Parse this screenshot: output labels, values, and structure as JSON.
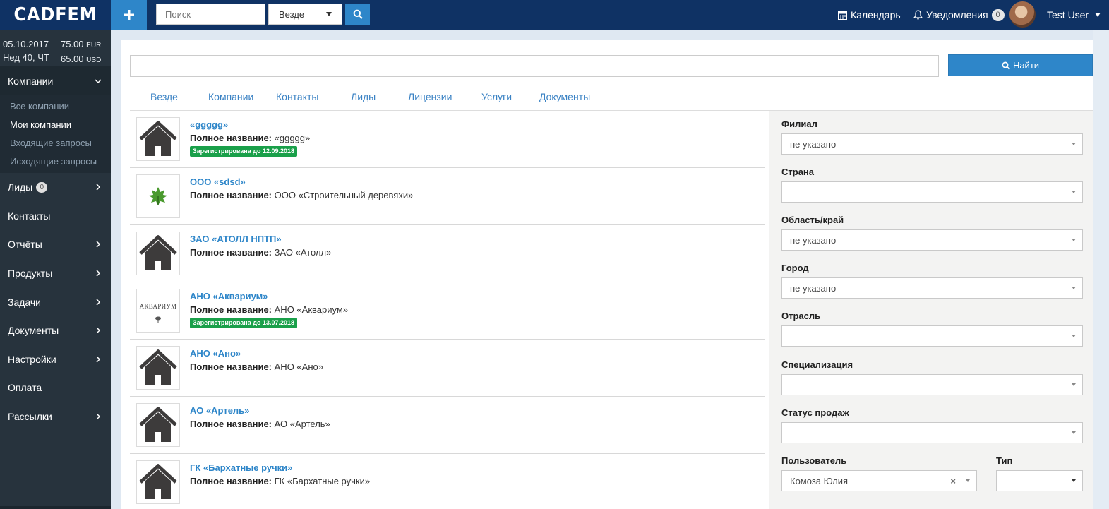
{
  "topbar": {
    "logo": "CADFEM",
    "search_placeholder": "Поиск",
    "scope_value": "Везде",
    "calendar_label": "Календарь",
    "notifications_label": "Уведомления",
    "notifications_count": "0",
    "user_name": "Test User"
  },
  "sidebar": {
    "date": "05.10.2017",
    "week": "Нед 40, ЧТ",
    "eur_rate": "75.00",
    "eur_code": "EUR",
    "usd_rate": "65.00",
    "usd_code": "USD",
    "active_section": "Компании",
    "sub_items": [
      "Все компании",
      "Мои компании",
      "Входящие запросы",
      "Исходящие запросы"
    ],
    "items": [
      "Лиды",
      "Контакты",
      "Отчёты",
      "Продукты",
      "Задачи",
      "Документы",
      "Настройки",
      "Оплата",
      "Рассылки"
    ],
    "leads_count": "0"
  },
  "search": {
    "find_label": "Найти"
  },
  "tabs": [
    "Везде",
    "Компании",
    "Контакты",
    "Лиды",
    "Лицензии",
    "Услуги",
    "Документы"
  ],
  "companies": [
    {
      "name": "«ggggg»",
      "full_label": "Полное название:",
      "full_name": "«ggggg»",
      "badge": "Зарегистрирована до 12.09.2018"
    },
    {
      "name": "ООО «sdsd»",
      "full_label": "Полное название:",
      "full_name": "ООО «Строительный деревяхи»"
    },
    {
      "name": "ЗАО «АТОЛЛ НПТП»",
      "full_label": "Полное название:",
      "full_name": "ЗАО «Атолл»"
    },
    {
      "name": "АНО «Аквариум»",
      "full_label": "Полное название:",
      "full_name": "АНО «Аквариум»",
      "badge": "Зарегистрирована до 13.07.2018",
      "logo_text": "АКВАРИУМ"
    },
    {
      "name": "АНО «Ано»",
      "full_label": "Полное название:",
      "full_name": "АНО «Ано»"
    },
    {
      "name": "АО «Артель»",
      "full_label": "Полное название:",
      "full_name": "АО «Артель»"
    },
    {
      "name": "ГК «Бархатные ручки»",
      "full_label": "Полное название:",
      "full_name": "ГК «Бархатные ручки»"
    }
  ],
  "filters": {
    "branch": {
      "label": "Филиал",
      "value": "не указано"
    },
    "country": {
      "label": "Страна",
      "value": ""
    },
    "region": {
      "label": "Область/край",
      "value": "не указано"
    },
    "city": {
      "label": "Город",
      "value": "не указано"
    },
    "industry": {
      "label": "Отрасль",
      "value": ""
    },
    "specialization": {
      "label": "Специализация",
      "value": ""
    },
    "sales_status": {
      "label": "Статус продаж",
      "value": ""
    },
    "user": {
      "label": "Пользователь",
      "value": "Комоза Юлия"
    },
    "type": {
      "label": "Тип",
      "value": ""
    }
  },
  "colors": {
    "topbar": "#0f3264",
    "accent": "#2e86c9",
    "sidebar": "#27333d",
    "badge_green": "#1aa04a"
  }
}
